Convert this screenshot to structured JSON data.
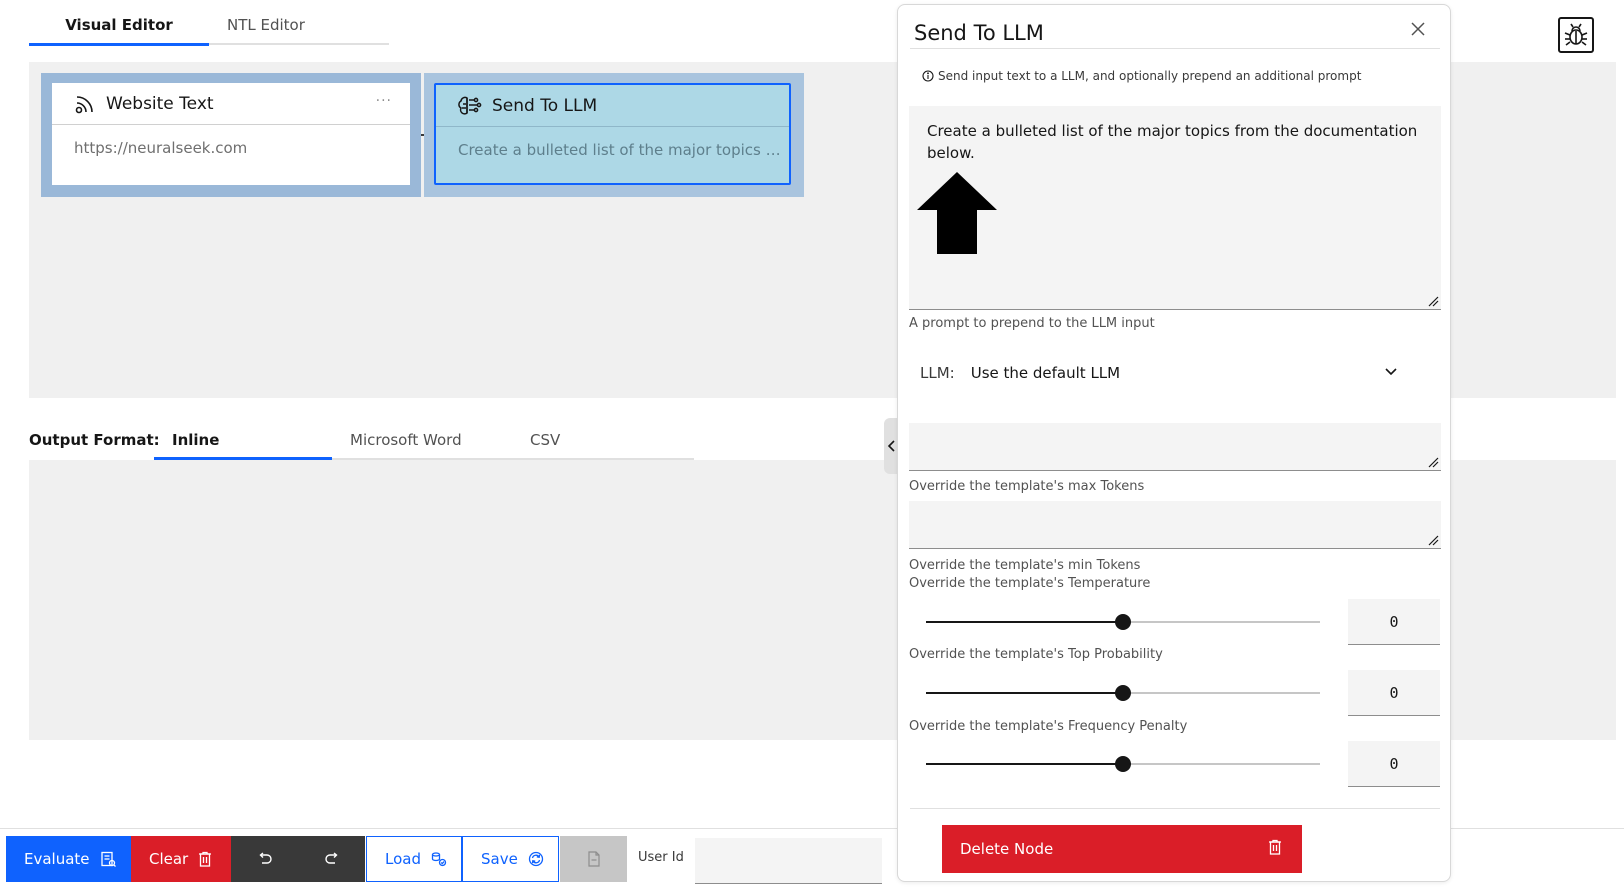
{
  "top_tabs": {
    "visual": "Visual Editor",
    "ntl": "NTL Editor"
  },
  "flow": {
    "nodes": [
      {
        "title": "Website Text",
        "body": "https://neuralseek.com",
        "icon": "rss-feed-icon",
        "menu": "···"
      },
      {
        "title": "Send To LLM",
        "body": "Create a bulleted list of the major topics fro...",
        "icon": "brain-circuit-icon"
      }
    ]
  },
  "output": {
    "label": "Output Format:",
    "tabs": [
      "Inline",
      "Microsoft Word",
      "CSV"
    ]
  },
  "toolbar": {
    "evaluate": "Evaluate",
    "clear": "Clear",
    "load": "Load",
    "save": "Save",
    "user_id_label": "User Id",
    "user_id_value": ""
  },
  "panel": {
    "title": "Send To LLM",
    "info": "Send input text to a LLM, and optionally prepend an additional prompt",
    "prompt_text": "Create a bulleted list of the major topics from the documentation below.",
    "prompt_help": "A prompt to prepend to the LLM input",
    "llm_label": "LLM:",
    "llm_value": "Use the default LLM",
    "max_tokens_value": "",
    "max_tokens_help": "Override the template's max Tokens",
    "min_tokens_value": "",
    "min_tokens_help": "Override the template's min Tokens",
    "temperature_help": "Override the template's Temperature",
    "temperature_value": "0",
    "temperature_slider_fraction": 0.5,
    "top_p_help": "Override the template's Top Probability",
    "top_p_value": "0",
    "top_p_slider_fraction": 0.5,
    "freq_help": "Override the template's Frequency Penalty",
    "freq_value": "0",
    "freq_slider_fraction": 0.5,
    "delete_label": "Delete Node"
  },
  "colors": {
    "primary": "#0f62fe",
    "danger": "#da1e28",
    "dark": "#393939",
    "node_selected": "#add8e6",
    "node_wrap": "#9ab8d8"
  }
}
